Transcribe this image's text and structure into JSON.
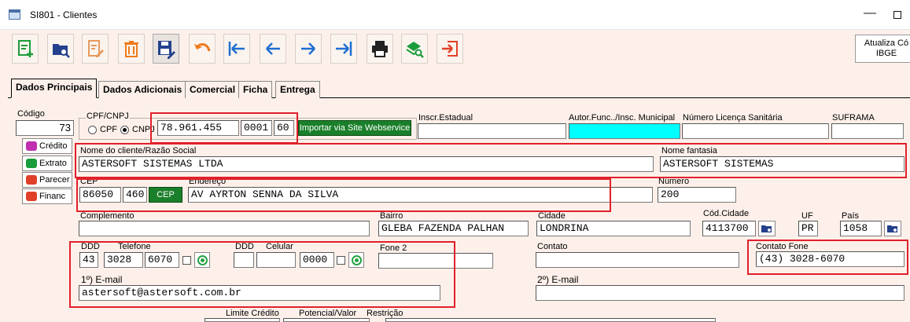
{
  "window": {
    "title": "SI801 - Clientes"
  },
  "toolbar": {
    "buttons": [
      {
        "name": "new-record",
        "icon": "add-document-icon"
      },
      {
        "name": "search",
        "icon": "folder-search-icon"
      },
      {
        "name": "edit",
        "icon": "edit-document-icon"
      },
      {
        "name": "delete",
        "icon": "trash-icon"
      },
      {
        "name": "save",
        "icon": "save-edit-icon"
      },
      {
        "name": "undo",
        "icon": "undo-icon"
      },
      {
        "name": "first",
        "icon": "first-record-icon"
      },
      {
        "name": "previous",
        "icon": "arrow-left-icon"
      },
      {
        "name": "next",
        "icon": "arrow-right-icon"
      },
      {
        "name": "last",
        "icon": "last-record-icon"
      },
      {
        "name": "print",
        "icon": "printer-icon"
      },
      {
        "name": "find",
        "icon": "search-stack-icon"
      },
      {
        "name": "exit",
        "icon": "exit-icon"
      }
    ],
    "update_ibge_line1": "Atualiza Có",
    "update_ibge_line2": "IBGE"
  },
  "tabs": {
    "dados_principais": "Dados Principais",
    "dados_adicionais": "Dados Adicionais",
    "comercial": "Comercial",
    "ficha": "Ficha",
    "entrega": "Entrega"
  },
  "side": {
    "codigo_label": "Código",
    "codigo_value": "73",
    "credito": "Crédito",
    "extrato": "Extrato",
    "parecer": "Parecer",
    "financ": "Financ"
  },
  "doc": {
    "group_label": "CPF/CNPJ",
    "cpf_label": "CPF",
    "cnpj_label": "CNPJ",
    "cnpj_part1": "78.961.455",
    "cnpj_part2": "0001",
    "cnpj_part3": "60",
    "import_button": "Importar via Site Webservice"
  },
  "fiscal": {
    "inscr_estadual_label": "Inscr.Estadual",
    "inscr_estadual_value": "",
    "autor_label": "Autor.Func../Insc. Municipal",
    "licenca_label": "Número Licença Sanitária",
    "suframa_label": "SUFRAMA"
  },
  "client": {
    "name_label": "Nome do cliente/Razão Social",
    "name_value": "ASTERSOFT SISTEMAS LTDA",
    "fantasy_label": "Nome fantasia",
    "fantasy_value": "ASTERSOFT SISTEMAS"
  },
  "address": {
    "cep_label": "CEP",
    "cep_part1": "86050",
    "cep_part2": "460",
    "cep_button": "CEP",
    "endereco_label": "Endereço",
    "endereco_value": "AV AYRTON SENNA DA SILVA",
    "numero_label": "Número",
    "numero_value": "200",
    "complemento_label": "Complemento",
    "bairro_label": "Bairro",
    "bairro_value": "GLEBA FAZENDA PALHAN",
    "cidade_label": "Cidade",
    "cidade_value": "LONDRINA",
    "cod_cidade_label": "Cód.Cidade",
    "cod_cidade_value": "4113700",
    "uf_label": "UF",
    "uf_value": "PR",
    "pais_label": "País",
    "pais_value": "1058"
  },
  "contact": {
    "ddd_label": "DDD",
    "telefone_label": "Telefone",
    "ddd_value": "43",
    "tel_part1": "3028",
    "tel_part2": "6070",
    "ddd2_label": "DDD",
    "celular_label": "Celular",
    "cel_part2": "0000",
    "fone2_label": "Fone 2",
    "contato_label": "Contato",
    "contato_fone_label": "Contato Fone",
    "contato_fone_value": "(43) 3028-6070",
    "email1_label": "1º) E-mail",
    "email1_value": "astersoft@astersoft.com.br",
    "email2_label": "2º) E-mail"
  },
  "bottom": {
    "limite_label": "Limite Crédito",
    "potencial_label": "Potencial/Valor",
    "restricao_label": "Restrição"
  },
  "colors": {
    "highlight": "#e0202a",
    "background": "#fdf0ea",
    "cyan_field": "#00ffff",
    "green_button": "#1a7f2a"
  }
}
